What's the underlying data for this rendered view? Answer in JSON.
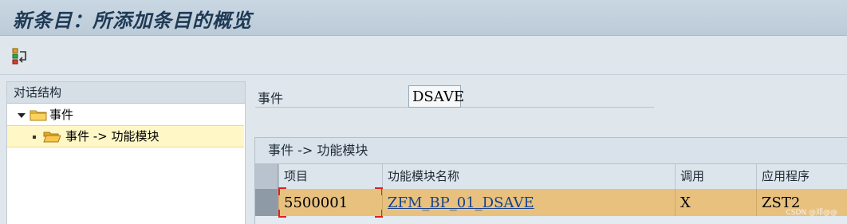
{
  "window": {
    "title": "新条目：所添加条目的概览"
  },
  "toolbar": {
    "icons": [
      "hierarchy-toggle-icon"
    ]
  },
  "dialog_structure": {
    "header": "对话结构",
    "nodes": [
      {
        "label": "事件",
        "icon": "folder-icon",
        "expanded": true
      },
      {
        "label": "事件 -> 功能模块",
        "icon": "folder-open-icon",
        "selected": true
      }
    ]
  },
  "detail": {
    "event_label": "事件",
    "event_value": "DSAVE",
    "table_title": "事件 -> 功能模块",
    "columns": [
      "项目",
      "功能模块名称",
      "调用",
      "应用程序"
    ],
    "rows": [
      [
        "5500001",
        "ZFM_BP_01_DSAVE",
        "X",
        "ZST2"
      ]
    ]
  },
  "watermark": "CSDN @邓@@",
  "colors": {
    "title_bg": "#c9d7e3",
    "selected_row": "#e8c17f",
    "tree_selected": "#fff7c6",
    "link": "#17418a"
  }
}
